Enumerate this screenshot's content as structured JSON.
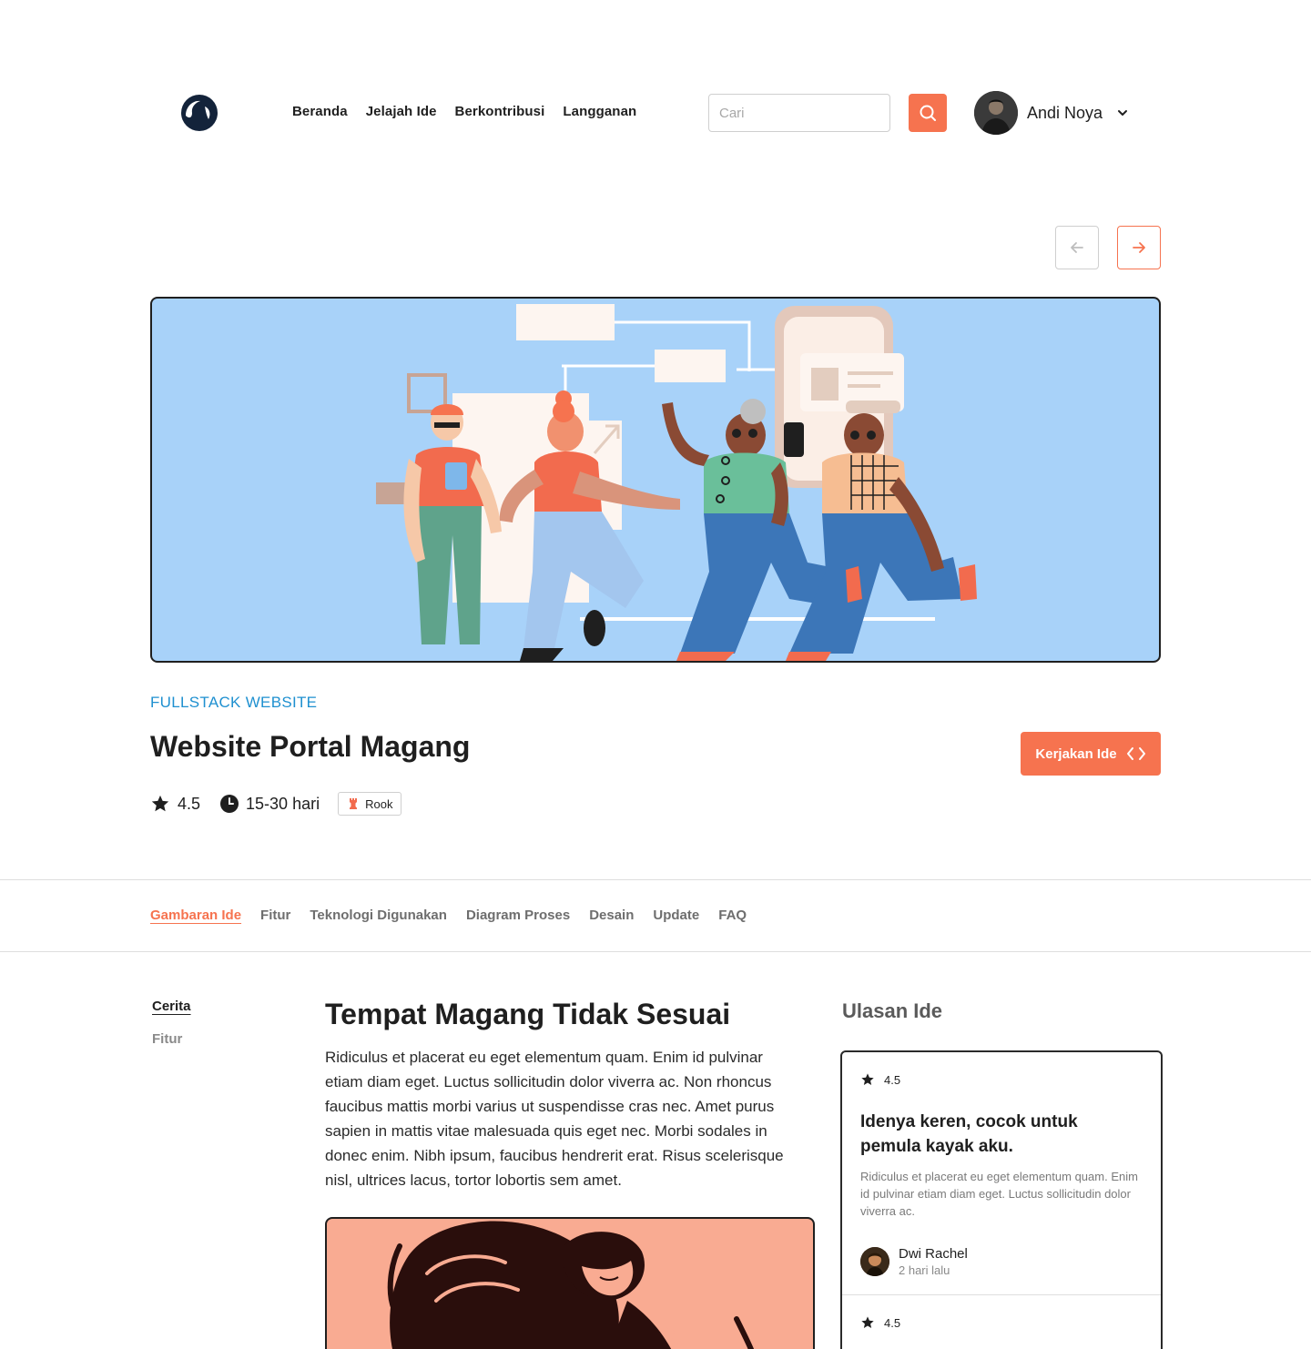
{
  "header": {
    "nav": [
      "Beranda",
      "Jelajah Ide",
      "Berkontribusi",
      "Langganan"
    ],
    "search_placeholder": "Cari",
    "user_name": "Andi Noya"
  },
  "idea": {
    "category": "FULLSTACK WEBSITE",
    "title": "Website Portal Magang",
    "cta_label": "Kerjakan Ide",
    "rating": "4.5",
    "duration": "15-30 hari",
    "level": "Rook"
  },
  "tabs": [
    "Gambaran Ide",
    "Fitur",
    "Teknologi Digunakan",
    "Diagram Proses",
    "Desain",
    "Update",
    "FAQ"
  ],
  "active_tab": "Gambaran Ide",
  "side_nav": [
    "Cerita",
    "Fitur"
  ],
  "article": {
    "title": "Tempat Magang Tidak Sesuai",
    "body": "Ridiculus et placerat eu eget elementum quam. Enim id pulvinar etiam diam eget. Luctus sollicitudin dolor viverra ac. Non rhoncus faucibus mattis morbi varius ut suspendisse cras nec. Amet purus sapien in mattis vitae malesuada quis eget nec. Morbi sodales in donec enim. Nibh ipsum, faucibus hendrerit erat. Risus scelerisque nisl, ultrices lacus, tortor lobortis sem amet."
  },
  "reviews": {
    "heading": "Ulasan Ide",
    "items": [
      {
        "rating": "4.5",
        "title": "Idenya keren, cocok untuk pemula kayak aku.",
        "text": "Ridiculus et placerat eu eget elementum quam. Enim id pulvinar etiam diam eget. Luctus sollicitudin dolor viverra ac.",
        "author": "Dwi Rachel",
        "time": "2 hari lalu"
      },
      {
        "rating": "4.5"
      }
    ]
  },
  "colors": {
    "accent": "#f6734f",
    "category": "#1f90d0",
    "hero_bg": "#a8d2f9",
    "article_image_bg": "#f9ab92"
  },
  "icons": [
    "logo-icon",
    "search-icon",
    "chevron-down-icon",
    "arrow-left-icon",
    "arrow-right-icon",
    "star-icon",
    "clock-icon",
    "code-icon",
    "rook-icon"
  ]
}
